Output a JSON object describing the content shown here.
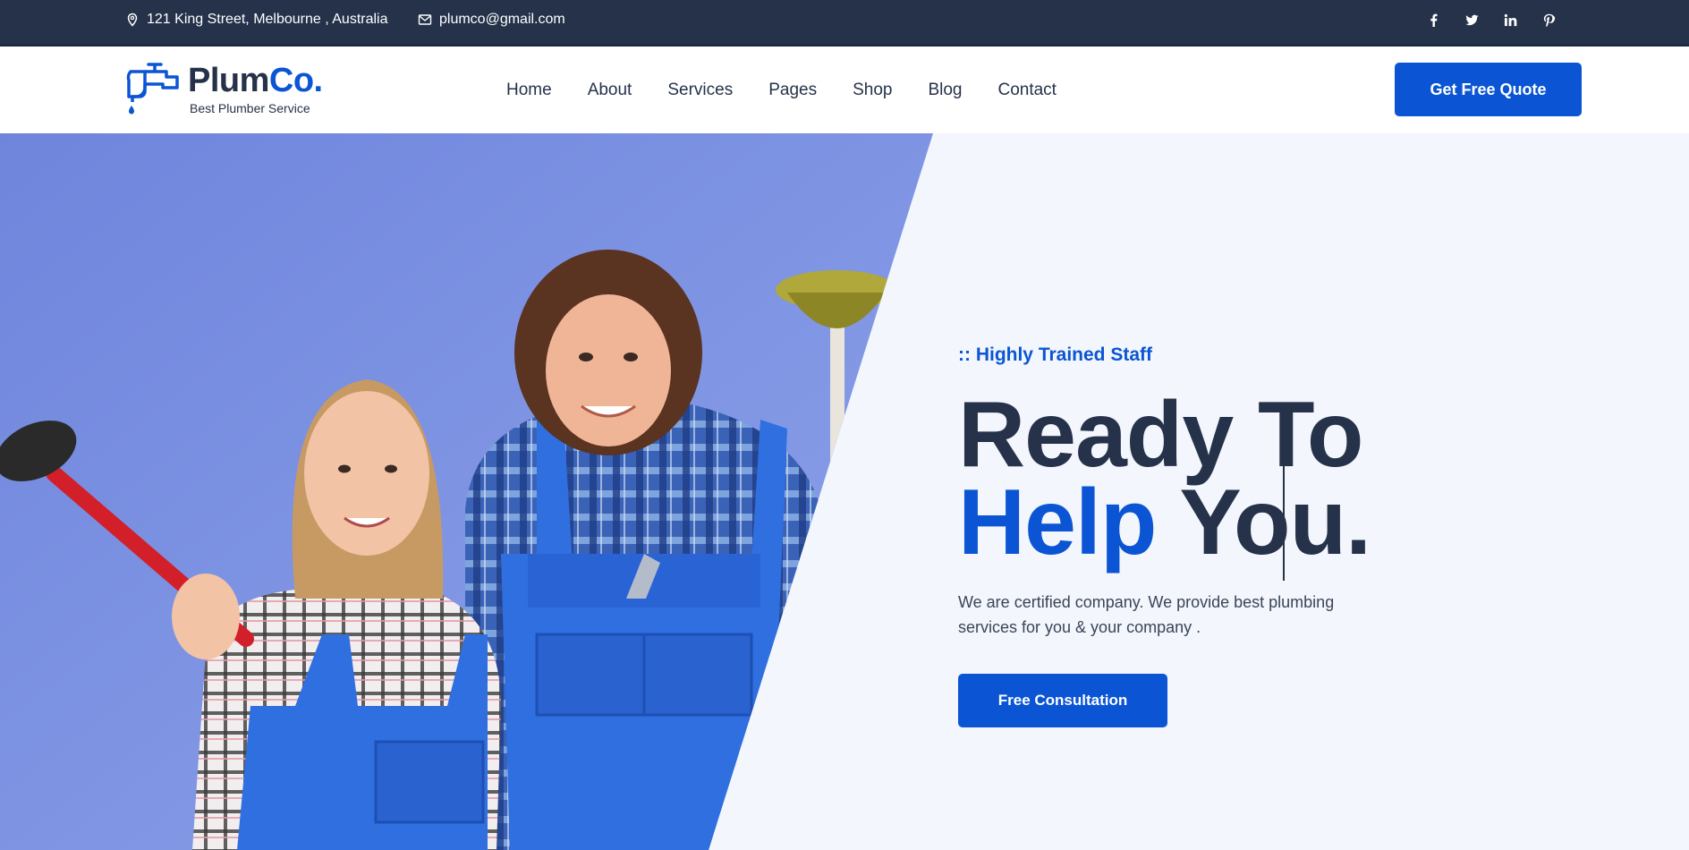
{
  "topbar": {
    "address": "121 King Street, Melbourne , Australia",
    "email": "plumco@gmail.com",
    "socials": [
      "facebook-icon",
      "twitter-icon",
      "linkedin-icon",
      "pinterest-icon"
    ]
  },
  "header": {
    "brand_main": "Plum",
    "brand_accent": "Co.",
    "tagline": "Best Plumber Service",
    "nav": [
      "Home",
      "About",
      "Services",
      "Pages",
      "Shop",
      "Blog",
      "Contact"
    ],
    "cta": "Get Free Quote"
  },
  "hero": {
    "eyebrow": ":: Highly Trained Staff",
    "headline_line1": "Ready To",
    "headline_blue": "Help",
    "headline_rest": " You.",
    "description": "We are certified company. We provide best plumbing services for you & your company .",
    "button": "Free Consultation"
  },
  "colors": {
    "primary": "#0b55d4",
    "dark": "#25324a",
    "hero_bg": "#f3f6fd",
    "photo_bg": "#7f95e2"
  }
}
